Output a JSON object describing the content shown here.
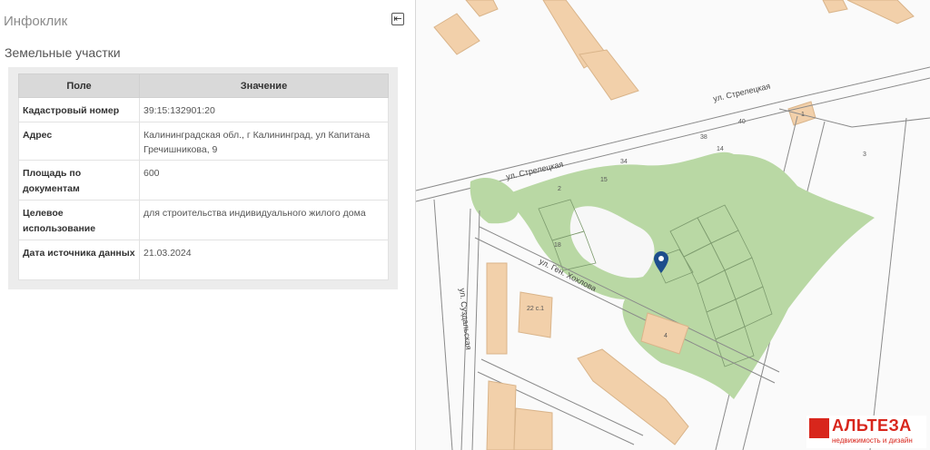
{
  "panel": {
    "title": "Инфоклик",
    "back_icon": "arrow-left-box-icon",
    "section_title": "Земельные участки"
  },
  "table": {
    "headers": [
      "Поле",
      "Значение"
    ],
    "rows": [
      {
        "key": "Кадастровый номер",
        "value": "39:15:132901:20"
      },
      {
        "key": "Адрес",
        "value": "Калининградская обл., г Калининград, ул Капитана Гречишникова, 9"
      },
      {
        "key": "Площадь по документам",
        "value": "600"
      },
      {
        "key": "Целевое использование",
        "value": "для строительства индивидуального жилого дома"
      },
      {
        "key": "Дата источника данных",
        "value": "21.03.2024"
      }
    ]
  },
  "map": {
    "streets": [
      "ул. Стрелецкая",
      "ул. Стрелецкая",
      "ул. Ген. Хохлова",
      "ул. Суздальская"
    ],
    "numbers": [
      "1",
      "40",
      "38",
      "14",
      "34",
      "3",
      "15",
      "2",
      "18",
      "22 с.1",
      "4"
    ],
    "marker_icon": "map-pin-icon"
  },
  "logo": {
    "name": "АЛЬТЕЗА",
    "tagline": "недвижимость и дизайн"
  },
  "colors": {
    "green_area": "#b9d8a4",
    "building": "#f2d0aa",
    "marker": "#1d4e8c",
    "brand": "#d8261c"
  }
}
